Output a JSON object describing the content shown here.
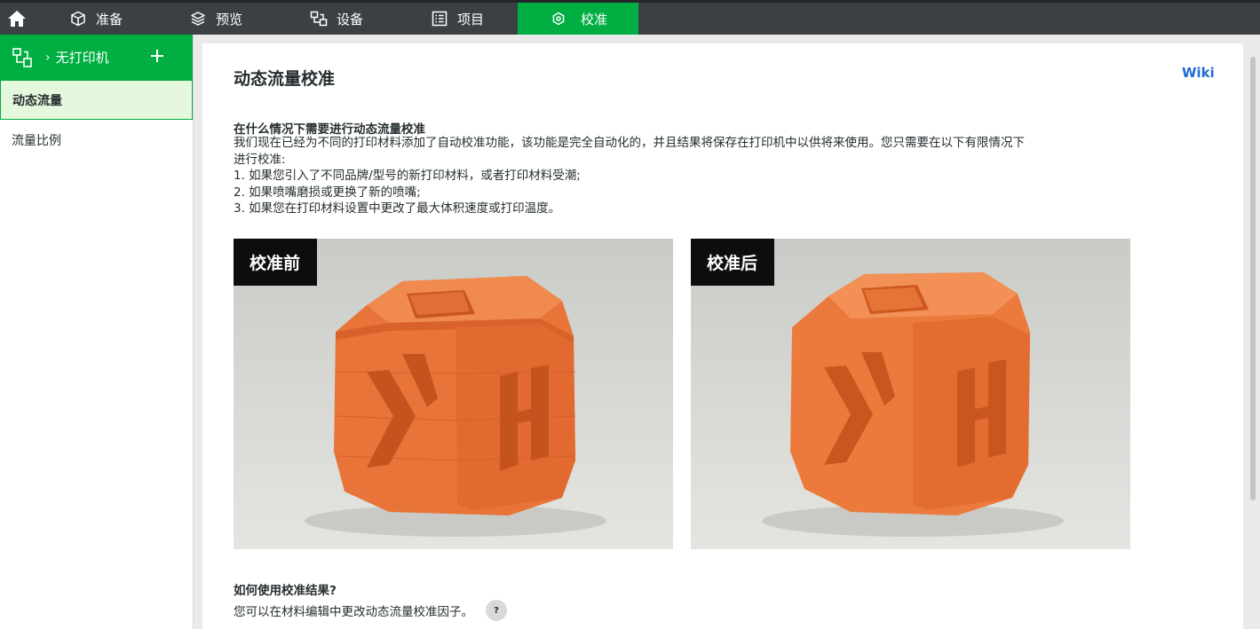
{
  "topbar": {
    "home_icon": "home-icon",
    "tabs": [
      {
        "label": "准备",
        "icon": "cube-icon"
      },
      {
        "label": "预览",
        "icon": "layers-icon"
      },
      {
        "label": "设备",
        "icon": "device-icon"
      },
      {
        "label": "项目",
        "icon": "project-icon"
      },
      {
        "label": "校准",
        "icon": "calibration-icon",
        "active": true
      }
    ],
    "active_color": "#00ae42"
  },
  "sidebar": {
    "printer_label": "无打印机",
    "printer_icon": "printer-connect-icon",
    "add_icon": "plus-icon",
    "items": [
      {
        "label": "动态流量",
        "active": true
      },
      {
        "label": "流量比例",
        "active": false
      }
    ]
  },
  "main": {
    "title": "动态流量校准",
    "wiki_label": "Wiki",
    "when_heading": "在什么情况下需要进行动态流量校准",
    "when_lines": [
      "我们现在已经为不同的打印材料添加了自动校准功能，该功能是完全自动化的，并且结果将保存在打印机中以供将来使用。您只需要在以下有限情况下",
      "进行校准:",
      "1. 如果您引入了不同品牌/型号的新打印材料，或者打印材料受潮;",
      "2. 如果喷嘴磨损或更换了新的喷嘴;",
      "3. 如果您在打印材料设置中更改了最大体积速度或打印温度。"
    ],
    "photo_before_label": "校准前",
    "photo_after_label": "校准后",
    "how_heading": "如何使用校准结果?",
    "how_text": "您可以在材料编辑中更改动态流量校准因子。",
    "help_label": "?"
  }
}
